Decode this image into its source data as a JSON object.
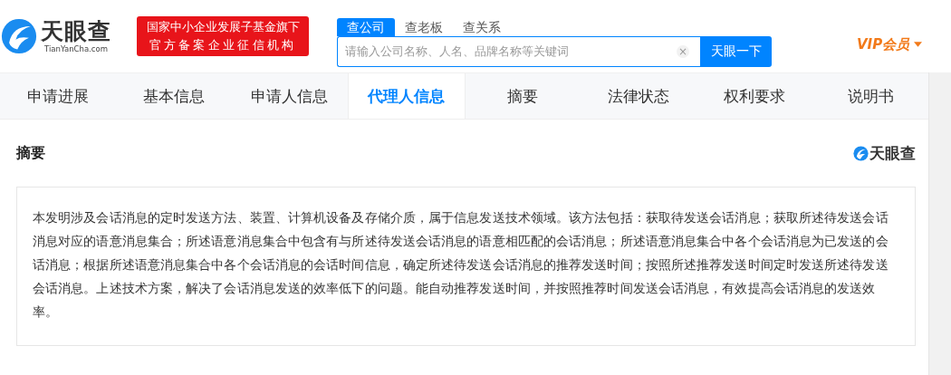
{
  "header": {
    "logo": {
      "name": "天眼查",
      "domain": "TianYanCha.com"
    },
    "slogan": [
      "国家中小企业发展子基金旗下",
      "官方备案企业征信机构"
    ],
    "search_tabs": [
      {
        "label": "查公司",
        "selected": true
      },
      {
        "label": "查老板",
        "selected": false
      },
      {
        "label": "查关系",
        "selected": false
      }
    ],
    "search": {
      "placeholder": "请输入公司名称、人名、品牌名称等关键词",
      "clear": "×",
      "button": "天眼一下"
    },
    "vip": "VIP会员"
  },
  "nav_tabs": [
    {
      "label": "申请进展",
      "selected": false
    },
    {
      "label": "基本信息",
      "selected": false
    },
    {
      "label": "申请人信息",
      "selected": false
    },
    {
      "label": "代理人信息",
      "selected": true
    },
    {
      "label": "摘要",
      "selected": false
    },
    {
      "label": "法律状态",
      "selected": false
    },
    {
      "label": "权利要求",
      "selected": false
    },
    {
      "label": "说明书",
      "selected": false
    }
  ],
  "section": {
    "title": "摘要",
    "watermark_logo": "天眼查",
    "text": "本发明涉及会话消息的定时发送方法、装置、计算机设备及存储介质，属于信息发送技术领域。该方法包括：获取待发送会话消息；获取所述待发送会话消息对应的语意消息集合；所述语意消息集合中包含有与所述待发送会话消息的语意相匹配的会话消息；所述语意消息集合中各个会话消息为已发送的会话消息；根据所述语意消息集合中各个会话消息的会话时间信息，确定所述待发送会话消息的推荐发送时间；按照所述推荐发送时间定时发送所述待发送会话消息。上述技术方案，解决了会话消息发送的效率低下的问题。能自动推荐发送时间，并按照推荐时间发送会话消息，有效提高会话消息的发送效率。"
  }
}
